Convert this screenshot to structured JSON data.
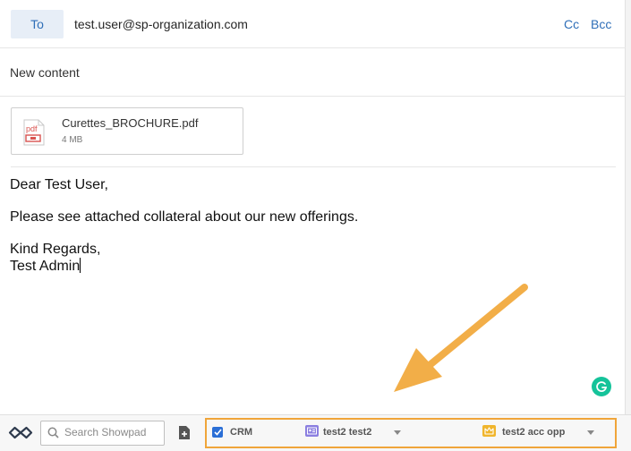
{
  "email": {
    "to_label": "To",
    "to_value": "test.user@sp-organization.com",
    "cc_label": "Cc",
    "bcc_label": "Bcc",
    "subject": "New content"
  },
  "attachment": {
    "icon_text": "pdf",
    "name": "Curettes_BROCHURE.pdf",
    "size": "4 MB"
  },
  "body": {
    "greeting": "Dear Test User,",
    "paragraph": "Please see attached collateral about our new offerings.",
    "closing": "Kind Regards,",
    "signature": "Test Admin"
  },
  "toolbar": {
    "search_placeholder": "Search Showpad",
    "crm_label": "CRM",
    "crm_checked": true,
    "contact": "test2 test2",
    "opportunity": "test2 acc opp"
  },
  "colors": {
    "accent": "#2f6fb8",
    "highlight": "#f0a53a",
    "grammarly": "#15c39a"
  }
}
